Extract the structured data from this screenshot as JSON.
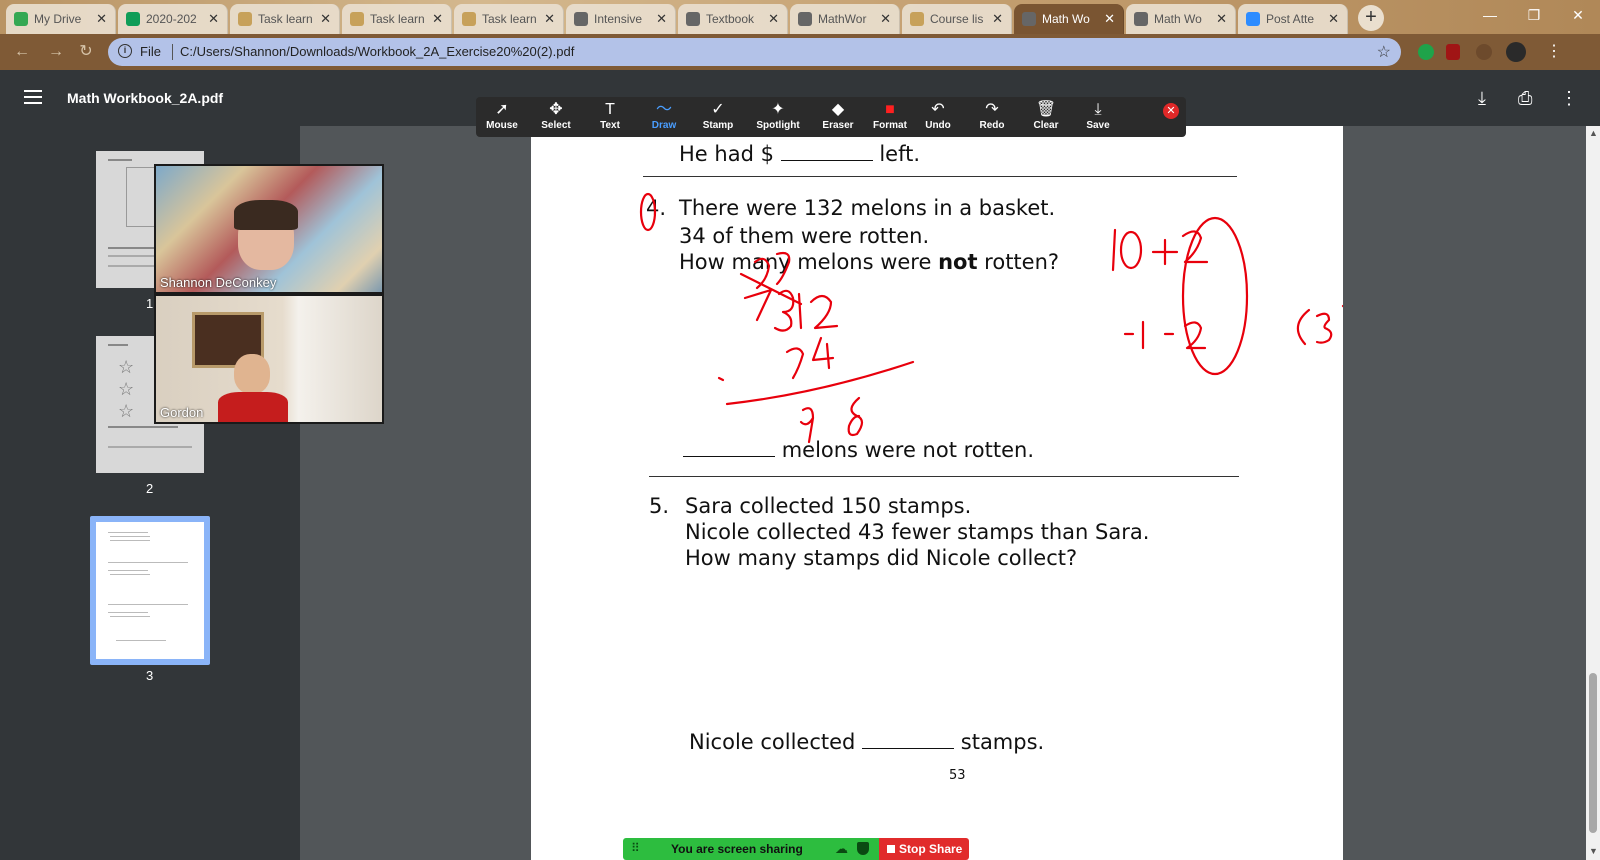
{
  "browser": {
    "tabs": [
      {
        "label": "My Drive",
        "icon": "google-drive-icon",
        "color": "#34a853"
      },
      {
        "label": "2020-202",
        "icon": "google-sheets-icon",
        "color": "#0f9d58"
      },
      {
        "label": "Task learn",
        "icon": "document-icon",
        "color": "#c7a15a"
      },
      {
        "label": "Task learn",
        "icon": "document-icon",
        "color": "#c7a15a"
      },
      {
        "label": "Task learn",
        "icon": "document-icon",
        "color": "#c7a15a"
      },
      {
        "label": "Intensive",
        "icon": "globe-icon",
        "color": "#666666"
      },
      {
        "label": "Textbook",
        "icon": "globe-icon",
        "color": "#666666"
      },
      {
        "label": "MathWor",
        "icon": "globe-icon",
        "color": "#666666"
      },
      {
        "label": "Course lis",
        "icon": "document-icon",
        "color": "#c7a15a"
      },
      {
        "label": "Math Wo",
        "icon": "globe-icon",
        "color": "#666666"
      },
      {
        "label": "Math Wo",
        "icon": "globe-icon",
        "color": "#666666"
      },
      {
        "label": "Post Atte",
        "icon": "zoom-icon",
        "color": "#2d8cff"
      }
    ],
    "active_tab": 9,
    "address": {
      "scheme_label": "File",
      "url": "C:/Users/Shannon/Downloads/Workbook_2A_Exercise20%20(2).pdf"
    }
  },
  "pdf": {
    "title": "Math Workbook_2A.pdf",
    "thumbnails": [
      {
        "number": "1"
      },
      {
        "number": "2"
      },
      {
        "number": "3"
      }
    ],
    "selected_page": "3"
  },
  "participants": [
    {
      "name": "Shannon DeConkey"
    },
    {
      "name": "Gordon"
    }
  ],
  "annotation_toolbar": {
    "tools": [
      {
        "label": "Mouse",
        "icon": "mouse-pointer-icon",
        "glyph": "➚"
      },
      {
        "label": "Select",
        "icon": "select-move-icon",
        "glyph": "✥"
      },
      {
        "label": "Text",
        "icon": "text-icon",
        "glyph": "T"
      },
      {
        "label": "Draw",
        "icon": "draw-icon",
        "glyph": "〜"
      },
      {
        "label": "Stamp",
        "icon": "stamp-check-icon",
        "glyph": "✓"
      },
      {
        "label": "Spotlight",
        "icon": "spotlight-wand-icon",
        "glyph": "✦"
      },
      {
        "label": "Eraser",
        "icon": "eraser-icon",
        "glyph": "◆"
      },
      {
        "label": "Format",
        "icon": "format-color-icon",
        "glyph": "■"
      },
      {
        "label": "Undo",
        "icon": "undo-icon",
        "glyph": "↶"
      },
      {
        "label": "Redo",
        "icon": "redo-icon",
        "glyph": "↷"
      },
      {
        "label": "Clear",
        "icon": "trash-icon",
        "glyph": "🗑"
      },
      {
        "label": "Save",
        "icon": "save-download-icon",
        "glyph": "⤓"
      }
    ],
    "active_tool": "Draw",
    "format_color": "#ff2020"
  },
  "document": {
    "prev_answer": {
      "prefix": "He had $",
      "suffix": "left."
    },
    "q4": {
      "number": "4.",
      "line1": "There were 132 melons in a basket.",
      "line2": "34 of them were rotten.",
      "line3_pre": "How many melons were ",
      "line3_bold": "not",
      "line3_post": " rotten?",
      "answer_suffix": "melons were not rotten."
    },
    "q5": {
      "number": "5.",
      "line1": "Sara collected 150 stamps.",
      "line2": "Nicole collected 43 fewer stamps than Sara.",
      "line3": "How many stamps did Nicole collect?",
      "answer_prefix": "Nicole collected",
      "answer_suffix": "stamps."
    },
    "page_number": "53",
    "ink_color": "#e8000c"
  },
  "share_bar": {
    "status": "You are screen sharing",
    "stop_label": "Stop Share",
    "green": "#2dbd3f",
    "red": "#e12b2b"
  }
}
